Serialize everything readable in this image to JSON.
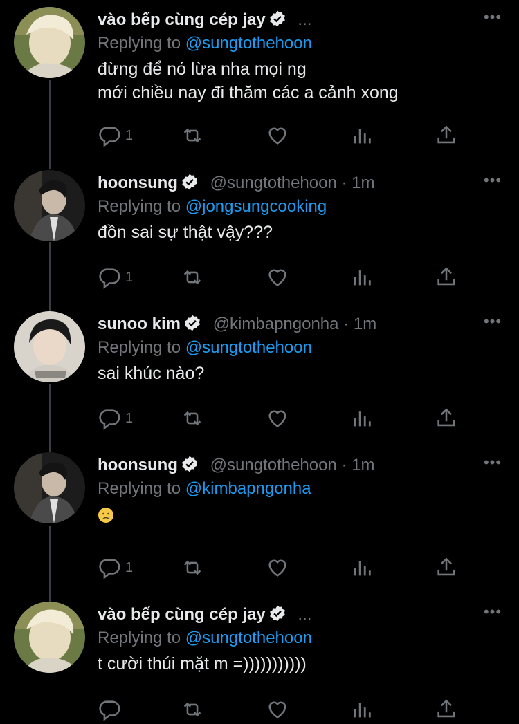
{
  "tweets": [
    {
      "name": "vào bếp cùng cép jay",
      "handle": "",
      "dot": "",
      "time": "",
      "trailing": "...",
      "replying_prefix": "Replying to",
      "replying_to": "@sungtothehoon",
      "lines": [
        "đừng để nó lừa nha mọi ng",
        "mới chiều nay đi thăm các a cảnh xong"
      ],
      "reply_count": "1"
    },
    {
      "name": "hoonsung",
      "handle": "@sungtothehoon",
      "dot": "·",
      "time": "1m",
      "trailing": "",
      "replying_prefix": "Replying to",
      "replying_to": "@jongsungcooking",
      "lines": [
        "đồn sai sự thật vậy???"
      ],
      "reply_count": "1"
    },
    {
      "name": "sunoo kim",
      "handle": "@kimbapngonha",
      "dot": "·",
      "time": "1m",
      "trailing": "",
      "replying_prefix": "Replying to",
      "replying_to": "@sungtothehoon",
      "lines": [
        "sai khúc nào?"
      ],
      "reply_count": "1"
    },
    {
      "name": "hoonsung",
      "handle": "@sungtothehoon",
      "dot": "·",
      "time": "1m",
      "trailing": "",
      "replying_prefix": "Replying to",
      "replying_to": "@kimbapngonha",
      "emoji": "crying-face-emoji",
      "reply_count": "1"
    },
    {
      "name": "vào bếp cùng cép jay",
      "handle": "",
      "dot": "",
      "time": "",
      "trailing": "...",
      "replying_prefix": "Replying to",
      "replying_to": "@sungtothehoon",
      "lines": [
        "t cười thúi mặt m =)))))))))))"
      ],
      "reply_count": ""
    }
  ],
  "more_menu": "•••",
  "colors": {
    "background": "#000000",
    "text": "#e7e9ea",
    "muted": "#71767b",
    "accent": "#1d9bf0",
    "thread_line": "#3a3d41"
  },
  "icons": [
    "reply-icon",
    "retweet-icon",
    "like-icon",
    "views-icon",
    "share-icon",
    "verified-icon",
    "more-icon"
  ]
}
